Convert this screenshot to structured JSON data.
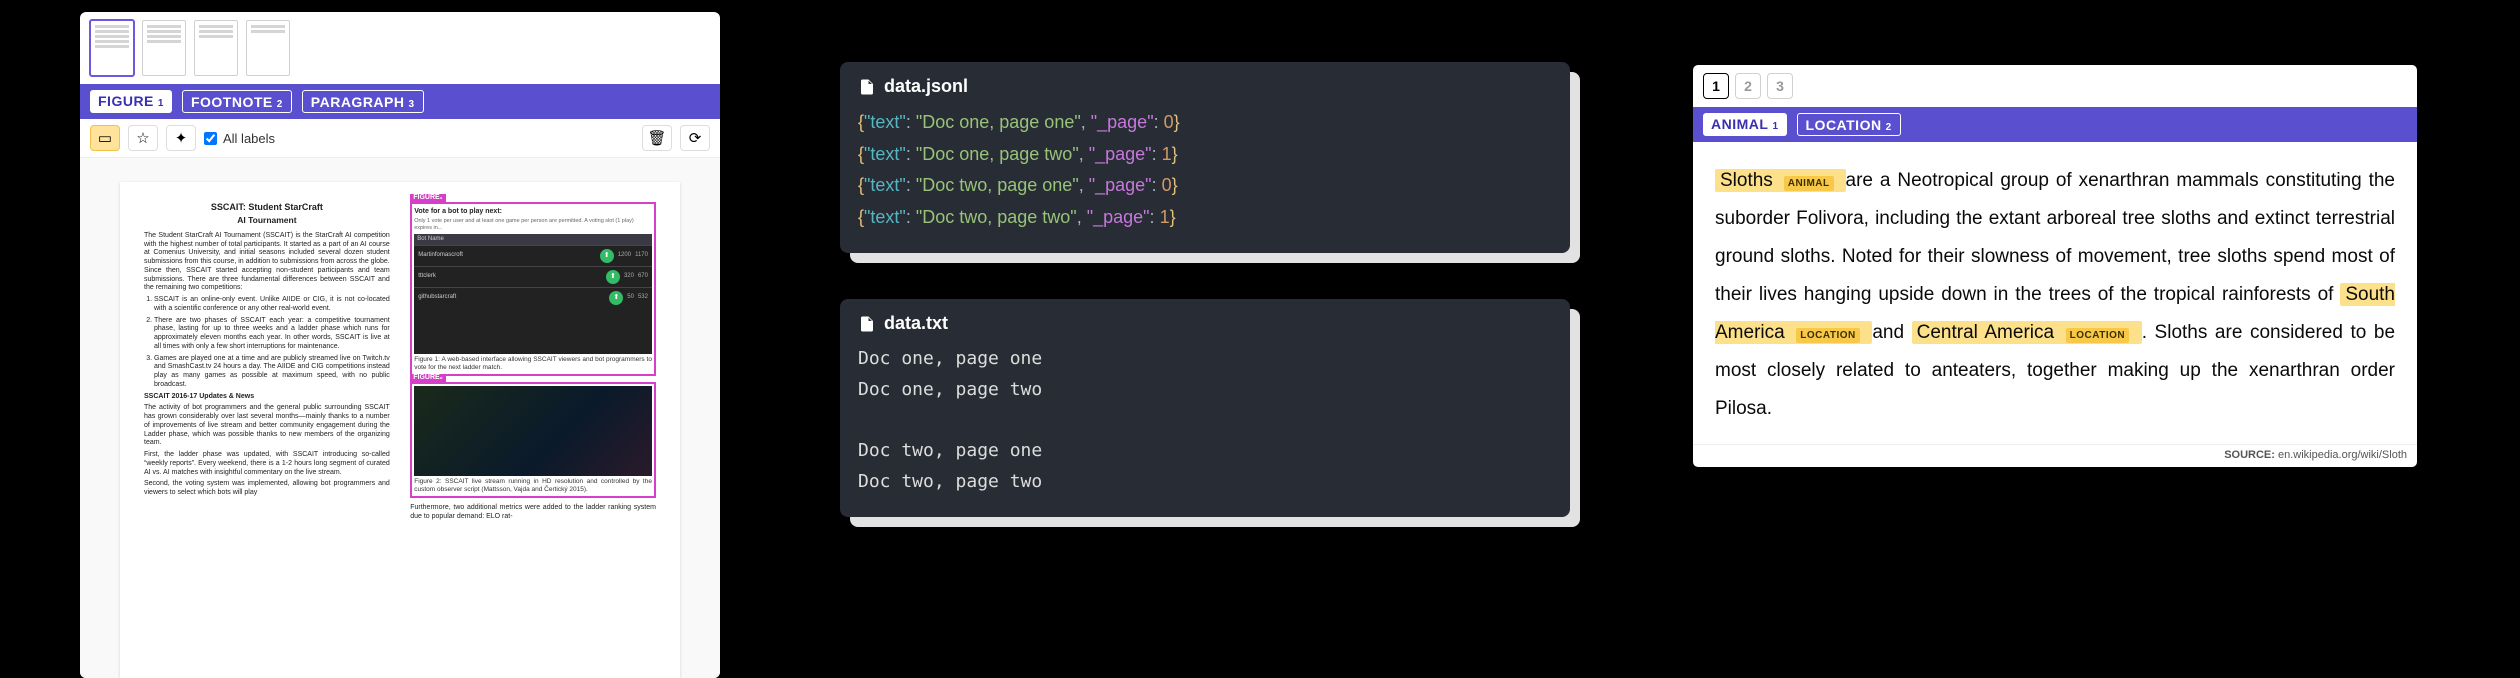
{
  "panelA": {
    "labels": [
      {
        "name": "FIGURE",
        "idx": "1",
        "selected": true
      },
      {
        "name": "FOOTNOTE",
        "idx": "2",
        "selected": false
      },
      {
        "name": "PARAGRAPH",
        "idx": "3",
        "selected": false
      }
    ],
    "allLabels": "All labels",
    "thumbs": [
      true,
      false,
      false,
      false
    ],
    "doc": {
      "title1": "SSCAIT: Student StarCraft",
      "title2": "AI Tournament",
      "lead": "The Student StarCraft AI Tournament (SSCAIT) is the StarCraft AI competition with the highest number of total participants. It started as a part of an AI course at Comenius University, and initial seasons included several dozen student submissions from this course, in addition to submissions from across the globe. Since then, SSCAIT started accepting non-student participants and team submissions. There are three fundamental differences between SSCAIT and the remaining two competitions:",
      "ol": [
        "SSCAIT is an online-only event. Unlike AIIDE or CIG, it is not co-located with a scientific conference or any other real-world event.",
        "There are two phases of SSCAIT each year: a competitive tournament phase, lasting for up to three weeks and a ladder phase which runs for approximately eleven months each year. In other words, SSCAIT is live at all times with only a few short interruptions for maintenance.",
        "Games are played one at a time and are publicly streamed live on Twitch.tv and SmashCast.tv 24 hours a day. The AIIDE and CIG competitions instead play as many games as possible at maximum speed, with no public broadcast."
      ],
      "h5": "SSCAIT 2016-17 Updates & News",
      "p2": "The activity of bot programmers and the general public surrounding SSCAIT has grown considerably over last several months—mainly thanks to a number of improvements of live stream and better community engagement during the Ladder phase, which was possible thanks to new members of the organizing team.",
      "p3": "First, the ladder phase was updated, with SSCAIT introducing so-called “weekly reports”. Every weekend, there is a 1-2 hours long segment of curated AI vs. AI matches with insightful commentary on the live stream.",
      "p4": "Second, the voting system was implemented, allowing bot programmers and viewers to select which bots will play",
      "p5": "Furthermore, two additional metrics were added to the ladder ranking system due to popular demand: ELO rat-",
      "fig1": {
        "tag": "FIGURE₁",
        "headline": "Vote for a bot to play next:",
        "sub": "Only 1 vote per user and at least one game per person are permitted. A voting slot (1 play) expires in...",
        "rows": [
          "Bot Name",
          "Martinfomascroft",
          "tttclerk",
          "githubstarcraft"
        ],
        "caption": "Figure 1: A web-based interface allowing SSCAIT viewers and bot programmers to vote for the next ladder match."
      },
      "fig2": {
        "tag": "FIGURE₂",
        "caption": "Figure 2: SSCAIT live stream running in HD resolution and controlled by the custom observer script (Mattsson, Vajda and Čertický 2015)."
      }
    }
  },
  "panelB": {
    "file1": "data.jsonl",
    "file2": "data.txt",
    "json_lines": [
      {
        "text": "Doc one, page one",
        "page": 0
      },
      {
        "text": "Doc one, page two",
        "page": 1
      },
      {
        "text": "Doc two, page one",
        "page": 0
      },
      {
        "text": "Doc two, page two",
        "page": 1
      }
    ],
    "txt": "Doc one, page one\nDoc one, page two\n\nDoc two, page one\nDoc two, page two"
  },
  "panelC": {
    "pages": [
      "1",
      "2",
      "3"
    ],
    "activePage": 0,
    "labels": [
      {
        "name": "ANIMAL",
        "idx": "1",
        "selected": true
      },
      {
        "name": "LOCATION",
        "idx": "2",
        "selected": false
      }
    ],
    "ents": {
      "sloths": "Sloths",
      "animal": "ANIMAL",
      "sa": "South America",
      "ca": "Central America",
      "location": "LOCATION"
    },
    "body_pre": " are a Neotropical group of xenarthran mammals constituting the suborder Folivora, including the extant arboreal tree sloths and extinct terrestrial ground sloths. Noted for their slowness of movement, tree sloths spend most of their lives hanging upside down in the trees of the tropical rainforests of ",
    "body_and": " and ",
    "body_post": " . Sloths are considered to be most closely related to anteaters, together making up the xenarthran order Pilosa.",
    "source_label": "SOURCE:",
    "source_url": "en.wikipedia.org/wiki/Sloth"
  }
}
